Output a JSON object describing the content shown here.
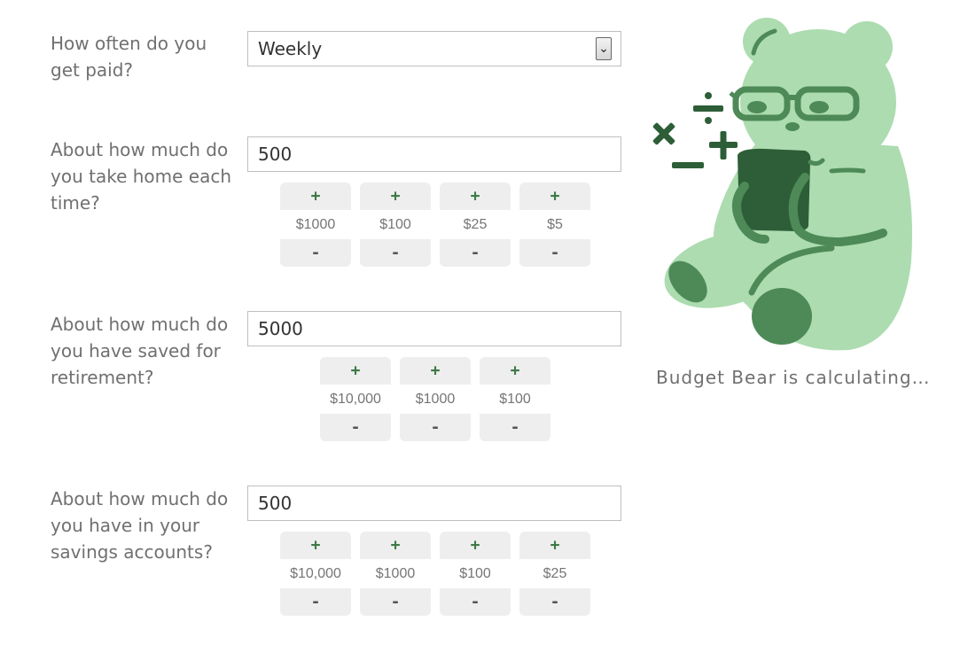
{
  "questions": [
    {
      "label": "How often do you get paid?",
      "value": "Weekly",
      "steppers": []
    },
    {
      "label": "About how much do you take home each time?",
      "value": "500",
      "steppers": [
        {
          "plus": "+",
          "amount": "$1000",
          "minus": "-"
        },
        {
          "plus": "+",
          "amount": "$100",
          "minus": "-"
        },
        {
          "plus": "+",
          "amount": "$25",
          "minus": "-"
        },
        {
          "plus": "+",
          "amount": "$5",
          "minus": "-"
        }
      ]
    },
    {
      "label": "About how much do you have saved for retirement?",
      "value": "5000",
      "steppers": [
        {
          "plus": "+",
          "amount": "$10,000",
          "minus": "-"
        },
        {
          "plus": "+",
          "amount": "$1000",
          "minus": "-"
        },
        {
          "plus": "+",
          "amount": "$100",
          "minus": "-"
        }
      ]
    },
    {
      "label": "About how much do you have in your savings accounts?",
      "value": "500",
      "steppers": [
        {
          "plus": "+",
          "amount": "$10,000",
          "minus": "-"
        },
        {
          "plus": "+",
          "amount": "$1000",
          "minus": "-"
        },
        {
          "plus": "+",
          "amount": "$100",
          "minus": "-"
        },
        {
          "plus": "+",
          "amount": "$25",
          "minus": "-"
        }
      ]
    }
  ],
  "status_text": "Budget Bear is calculating…",
  "icons": {
    "select_arrow": "chevron-down-icon",
    "mascot": "budget-bear-illustration"
  },
  "colors": {
    "bear_light": "#acdcb0",
    "bear_mid": "#4e8a58",
    "bear_dark": "#2d5e37",
    "accent_green": "#3d7a45"
  }
}
